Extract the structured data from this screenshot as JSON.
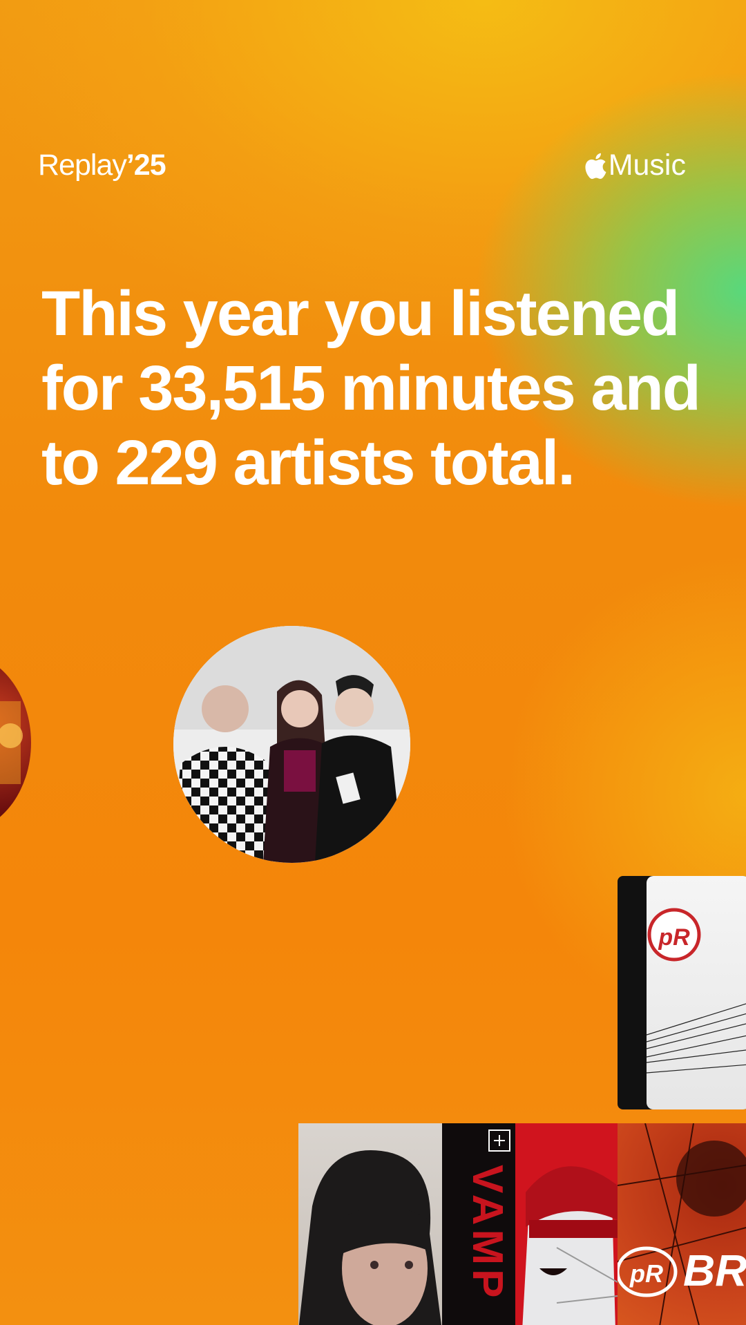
{
  "header": {
    "brand": "Replay",
    "brand_year": "’25",
    "service": "Music",
    "apple_logo_icon": "apple-logo-icon"
  },
  "headline": {
    "text": "This year you listened for 33,515 minutes and to 229 artists total."
  },
  "images": {
    "artist_main": "band-photo",
    "artist_left": "artist-photo-partial",
    "album_pr": "pr-record-album-art",
    "album_face": "portrait-album-art",
    "album_vamp": "vamp-album-art",
    "album_mask": "masked-figure-album-art",
    "album_brat": "brat-album-art",
    "brand_marks": {
      "pr_logo": "pR",
      "vamp_text": "VAMP",
      "brat_text": "BRAT"
    }
  },
  "colors": {
    "accent_orange": "#f28a0c",
    "accent_yellow": "#f5be14",
    "accent_green": "#52dc82",
    "text": "#ffffff"
  }
}
